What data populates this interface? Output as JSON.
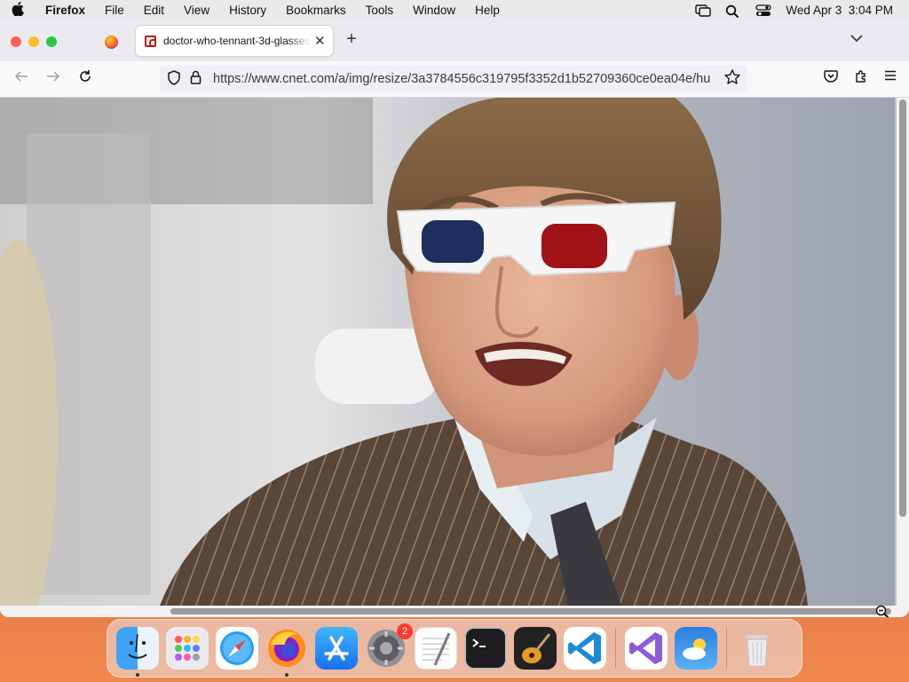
{
  "menubar": {
    "apple": "",
    "app": "Firefox",
    "items": [
      "File",
      "Edit",
      "View",
      "History",
      "Bookmarks",
      "Tools",
      "Window",
      "Help"
    ],
    "datetime": "Wed Apr 3  3:04 PM"
  },
  "browser": {
    "tab_title": "doctor-who-tennant-3d-glasses",
    "url": "https://www.cnet.com/a/img/resize/3a3784556c319795f3352d1b52709360ce0ea04e/hu",
    "new_tab": "+",
    "close": "✕"
  },
  "dock": {
    "apps": [
      "finder-icon",
      "launchpad-icon",
      "safari-icon",
      "firefox-icon",
      "app-store-icon",
      "system-settings-icon",
      "textedit-icon",
      "terminal-icon",
      "garageband-icon",
      "vscode-icon",
      "visual-studio-icon",
      "weather-icon",
      "trash-icon"
    ],
    "settings_badge": "2"
  },
  "colors": {
    "accent": "#0060df",
    "close": "#ff5f57",
    "minimize": "#febc2e",
    "maximize": "#28c840"
  }
}
